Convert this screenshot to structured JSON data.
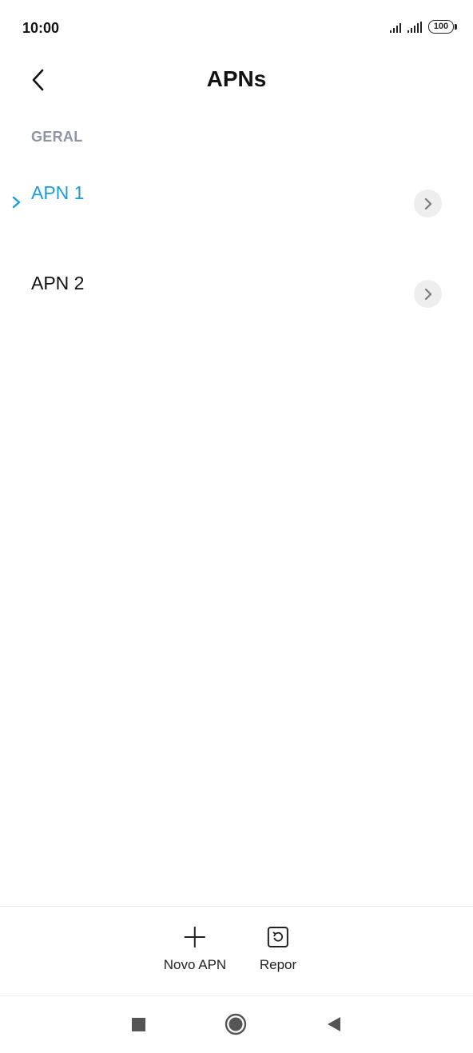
{
  "status_bar": {
    "time": "10:00",
    "battery": "100"
  },
  "header": {
    "title": "APNs"
  },
  "section": {
    "label": "GERAL"
  },
  "apns": [
    {
      "label": "APN 1",
      "selected": true
    },
    {
      "label": "APN 2",
      "selected": false
    }
  ],
  "toolbar": {
    "add_label": "Novo APN",
    "reset_label": "Repor"
  },
  "colors": {
    "accent": "#1a9ddf",
    "section_label": "#8f93a6",
    "chevron_bg": "#eeeeee"
  },
  "icons": {
    "back": "back-arrow-icon",
    "chevron": "chevron-right-icon",
    "add": "plus-icon",
    "reset": "reset-icon",
    "nav_recents": "square-icon",
    "nav_home": "circle-icon",
    "nav_back": "triangle-back-icon"
  }
}
